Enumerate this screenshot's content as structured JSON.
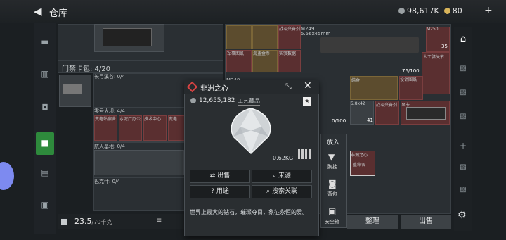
{
  "header": {
    "back_glyph": "◀",
    "title": "仓库",
    "silver_amount": "98,617K",
    "gold_amount": "80",
    "plus_glyph": "+"
  },
  "storage": {
    "card_pack_label": "门禁卡包: 4/20",
    "changhong": "长弓溪谷: 0/4",
    "zero_dam": "零号大坝: 4/4",
    "space_base": "航天基地: 0/4",
    "bakshi": "巴克什: 0/4",
    "weight": "23.5",
    "weight_max": "/70千克",
    "card_labels": [
      "变电站宿舍",
      "水泥厂办公",
      "技术中心",
      "变电"
    ]
  },
  "inventory": {
    "row1_labels": [
      "",
      "",
      "战斗兴奋剂",
      "M249",
      "5.56x45mm",
      "M250"
    ],
    "row2_labels": [
      "军事图纸",
      "海盗金币",
      "实验数据"
    ],
    "ammo_count": "35",
    "prosthetic_label": "人工膝关节",
    "capacity": "76/100",
    "m249_label": "M249",
    "ammo2": "5.8x42",
    "ammo2_count": "41",
    "stim_label": "战斗兴奋剂",
    "gold_chain": "纯金",
    "design_label": "设计图纸",
    "gpu_label": "显卡",
    "capacity_zero": "0/100",
    "selected_item_label": "非洲之心",
    "selected_item_sub": "重命名"
  },
  "popup": {
    "item_name": "非洲之心",
    "price": "12,655,182",
    "tag": "工艺藏品",
    "weight": "0.62KG",
    "sell": "出售",
    "source": "来源",
    "usage": "用途",
    "search": "搜索关联",
    "description": "世界上最大的钻石，璀璨夺目，象征永恒的爱。"
  },
  "sidepop": {
    "put_in": "放入",
    "chest": "胸挂",
    "backpack": "背包",
    "safebox": "安全箱"
  },
  "bottom": {
    "sort": "整理",
    "sell": "出售"
  },
  "colors": {
    "accent_green": "#2e8a3c",
    "rare_red": "#d64342",
    "gold": "#d8b45a"
  }
}
